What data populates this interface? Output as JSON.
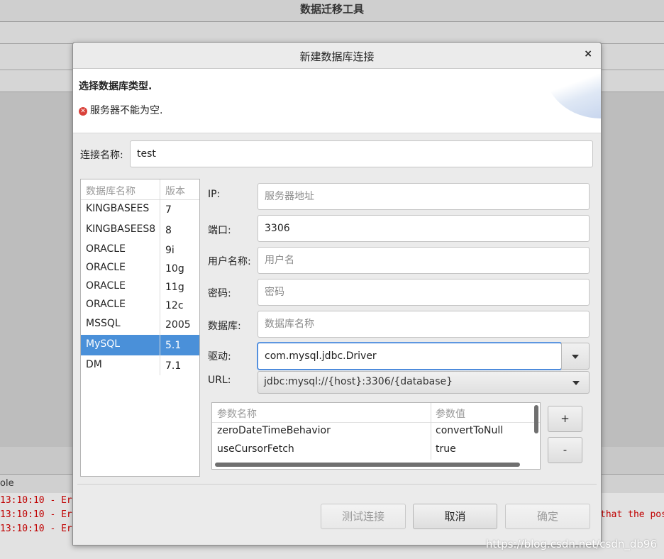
{
  "main_window": {
    "title": "数据迁移工具",
    "console_label": "ole",
    "console_lines": [
      {
        "text": "13:10:10 - Err",
        "tail": ""
      },
      {
        "text": "13:10:10 - Err",
        "tail": "that the pos"
      },
      {
        "text": "13:10:10 - Err",
        "tail": ""
      }
    ],
    "watermark": "https://blog.csdn.net/csdn_db96"
  },
  "dialog": {
    "title": "新建数据库连接",
    "close_glyph": "×",
    "banner": {
      "heading": "选择数据库类型.",
      "error_glyph": "✕",
      "error_text": "服务器不能为空."
    },
    "connection_name": {
      "label": "连接名称:",
      "value": "test"
    },
    "db_list": {
      "headers": {
        "name": "数据库名称",
        "version": "版本"
      },
      "rows": [
        {
          "name": "KINGBASEES",
          "version": "7"
        },
        {
          "name": "KINGBASEES8",
          "version": "8"
        },
        {
          "name": "ORACLE",
          "version": "9i"
        },
        {
          "name": "ORACLE",
          "version": "10g"
        },
        {
          "name": "ORACLE",
          "version": "11g"
        },
        {
          "name": "ORACLE",
          "version": "12c"
        },
        {
          "name": "MSSQL",
          "version": "2005"
        },
        {
          "name": "MySQL",
          "version": "5.1"
        },
        {
          "name": "DM",
          "version": "7.1"
        }
      ],
      "selected_index": 7
    },
    "form": {
      "ip": {
        "label": "IP:",
        "value": "",
        "placeholder": "服务器地址"
      },
      "port": {
        "label": "端口:",
        "value": "3306",
        "placeholder": ""
      },
      "user": {
        "label": "用户名称:",
        "value": "",
        "placeholder": "用户名"
      },
      "password": {
        "label": "密码:",
        "value": "",
        "placeholder": "密码"
      },
      "database": {
        "label": "数据库:",
        "value": "",
        "placeholder": "数据库名称"
      },
      "driver": {
        "label": "驱动:",
        "value": "com.mysql.jdbc.Driver"
      },
      "url": {
        "label": "URL:",
        "value": "jdbc:mysql://{host}:3306/{database}"
      }
    },
    "params": {
      "headers": {
        "name": "参数名称",
        "value": "参数值"
      },
      "rows": [
        {
          "name": "zeroDateTimeBehavior",
          "value": "convertToNull"
        },
        {
          "name": "useCursorFetch",
          "value": "true"
        }
      ],
      "add_label": "+",
      "remove_label": "-"
    },
    "buttons": {
      "test": "测试连接",
      "cancel": "取消",
      "ok": "确定"
    }
  }
}
